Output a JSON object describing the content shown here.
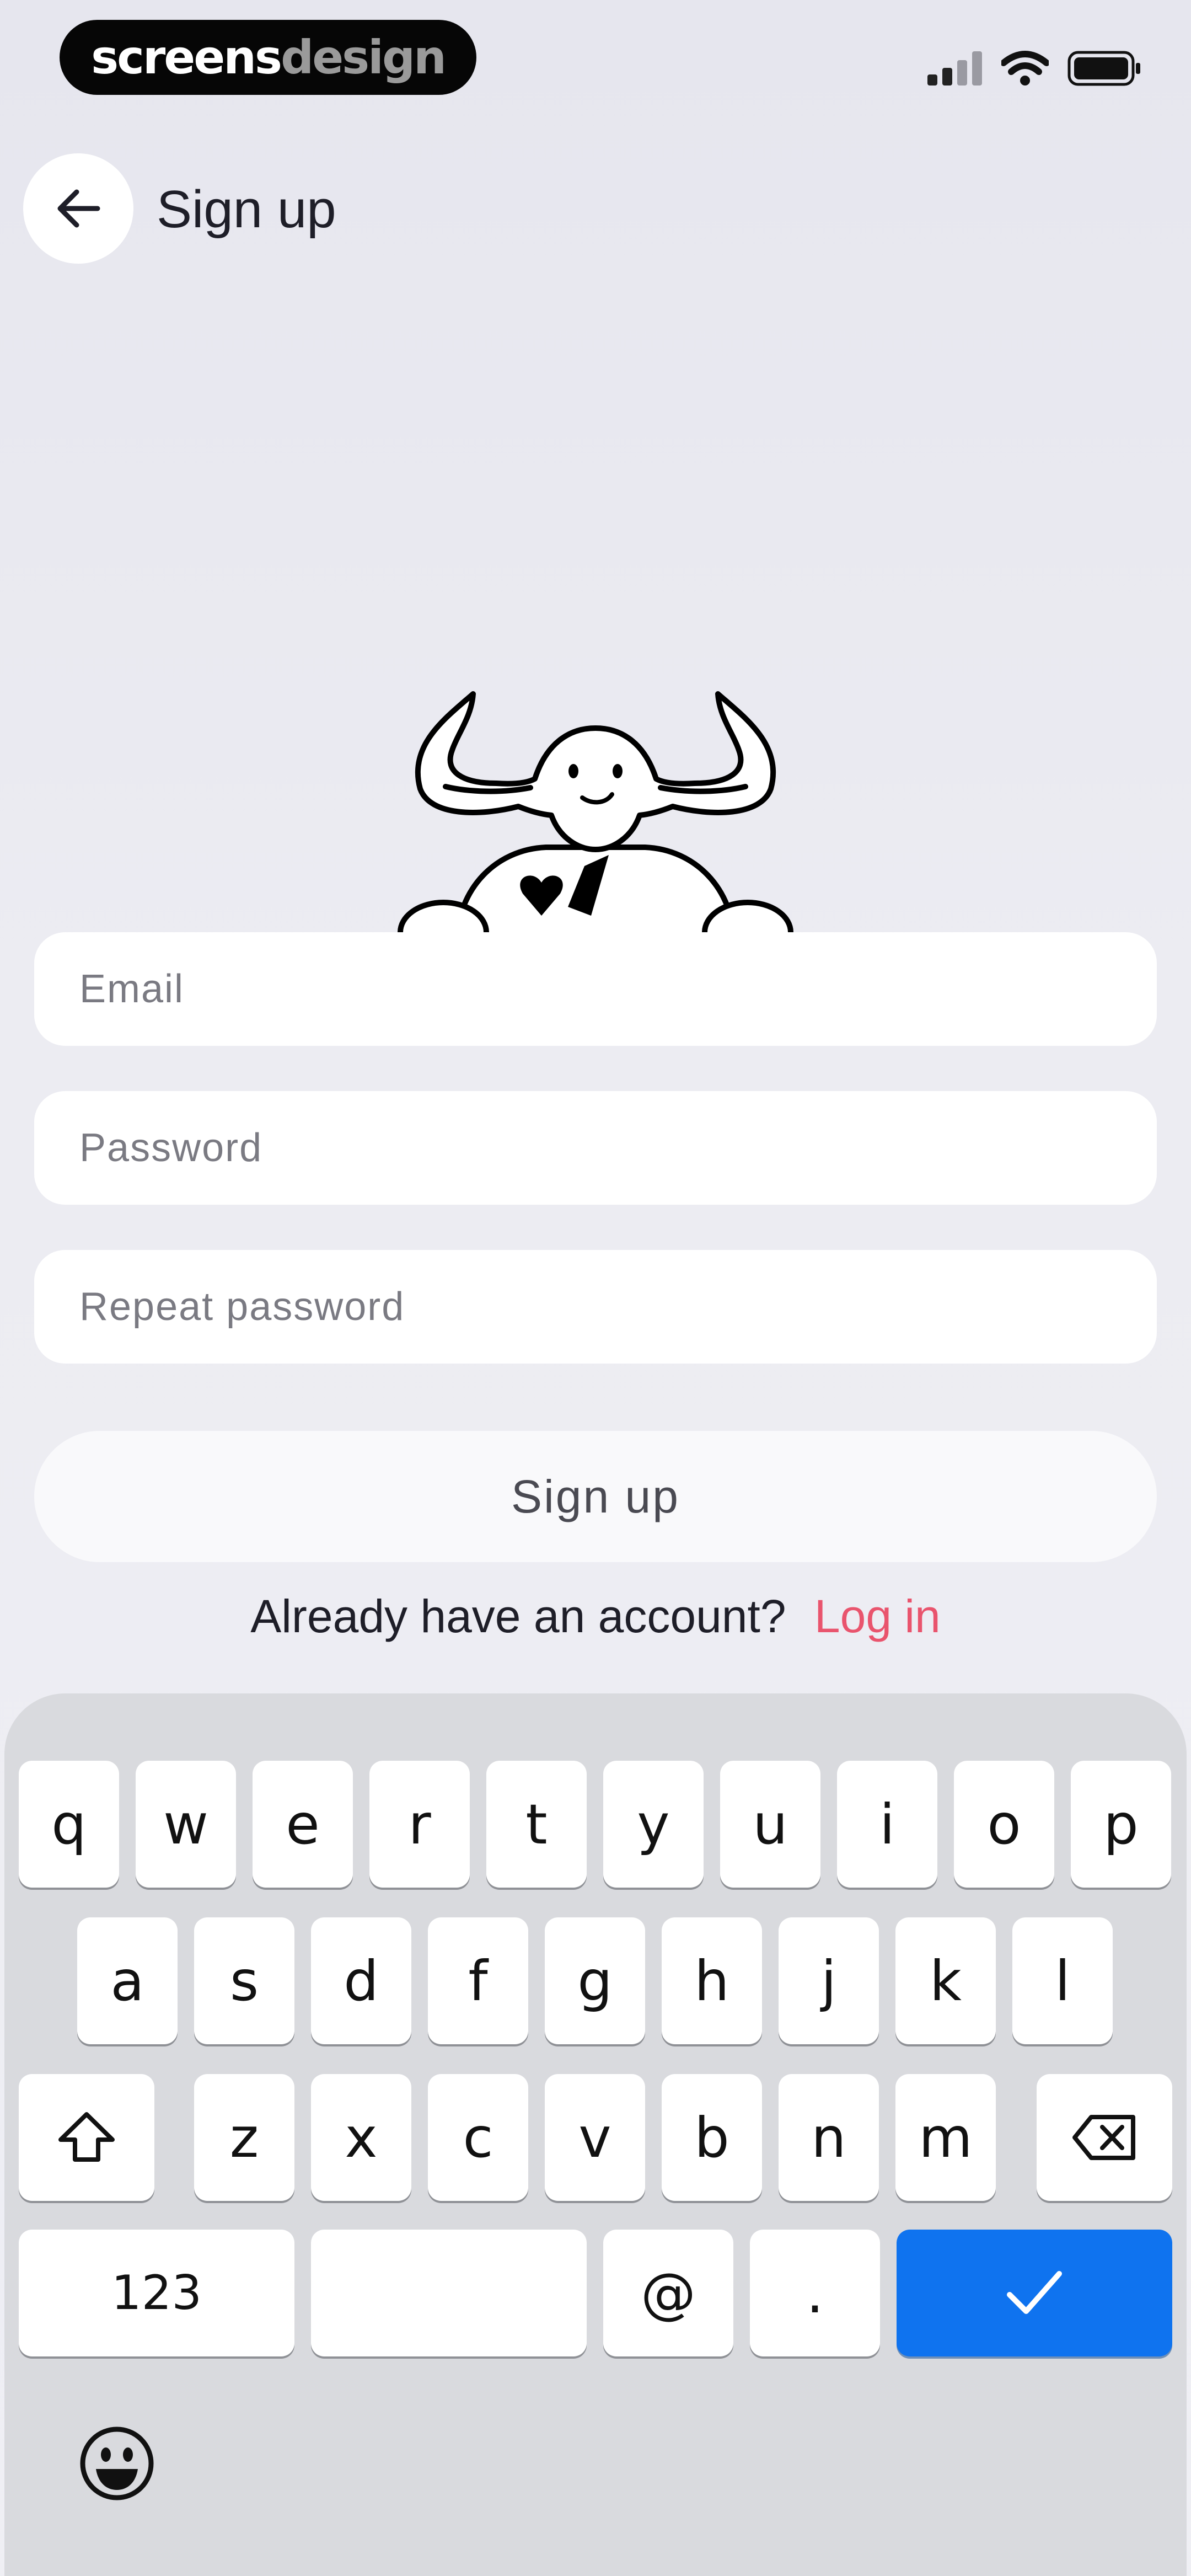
{
  "status_bar": {
    "brand_part1": "screens",
    "brand_part2": "design",
    "icons": [
      "signal-icon",
      "wifi-icon",
      "battery-icon"
    ]
  },
  "header": {
    "back_icon": "arrow-left-icon",
    "title": "Sign up"
  },
  "mascot": {
    "icon": "bull-mascot"
  },
  "form": {
    "email_placeholder": "Email",
    "password_placeholder": "Password",
    "repeat_password_placeholder": "Repeat password",
    "submit_label": "Sign up"
  },
  "footer": {
    "prompt": "Already have an account?",
    "login_label": "Log in"
  },
  "keyboard": {
    "row1": [
      "q",
      "w",
      "e",
      "r",
      "t",
      "y",
      "u",
      "i",
      "o",
      "p"
    ],
    "row2": [
      "a",
      "s",
      "d",
      "f",
      "g",
      "h",
      "j",
      "k",
      "l"
    ],
    "row3": [
      "z",
      "x",
      "c",
      "v",
      "b",
      "n",
      "m"
    ],
    "numbers_label": "123",
    "at_label": "@",
    "dot_label": ".",
    "shift_icon": "shift-icon",
    "backspace_icon": "backspace-icon",
    "done_icon": "checkmark-icon",
    "emoji_icon": "emoji-icon"
  },
  "colors": {
    "accent_blue": "#0f73ef",
    "link_pink": "#e9546d",
    "background": "#ececf2",
    "keyboard_bg": "#d9dade"
  }
}
